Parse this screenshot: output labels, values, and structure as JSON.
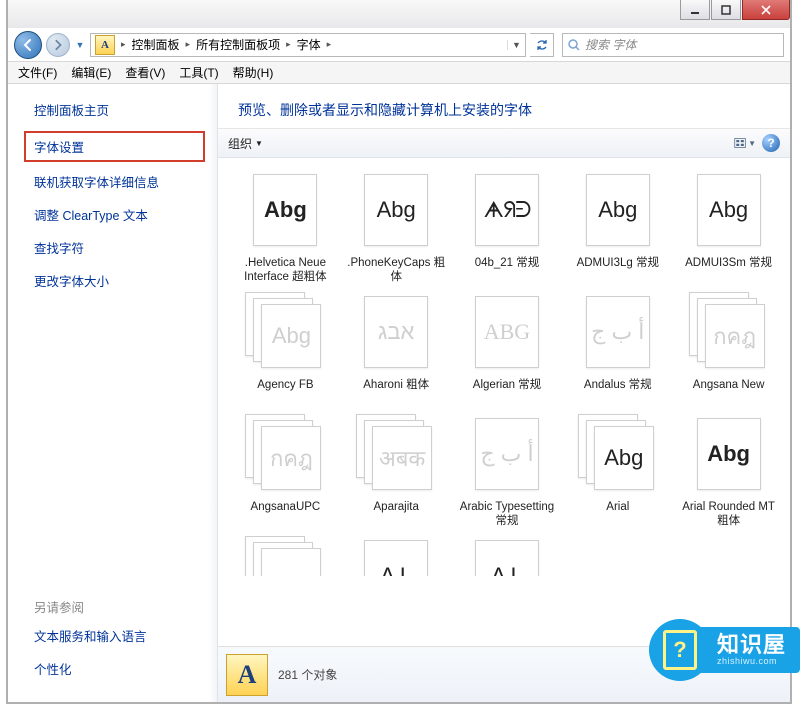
{
  "window": {
    "breadcrumbs": [
      "控制面板",
      "所有控制面板项",
      "字体"
    ],
    "search_placeholder": "搜索 字体"
  },
  "menu": {
    "file": "文件(F)",
    "edit": "编辑(E)",
    "view": "查看(V)",
    "tools": "工具(T)",
    "help": "帮助(H)"
  },
  "sidebar": {
    "home": "控制面板主页",
    "links": [
      "字体设置",
      "联机获取字体详细信息",
      "调整 ClearType 文本",
      "查找字符",
      "更改字体大小"
    ],
    "see_also_header": "另请参阅",
    "see_also": [
      "文本服务和输入语言",
      "个性化"
    ]
  },
  "content": {
    "title": "预览、删除或者显示和隐藏计算机上安装的字体",
    "organize": "组织"
  },
  "fonts": [
    {
      "label": ".Helvetica Neue Interface 超粗体",
      "sample": "Abg",
      "stack": false,
      "style": "heavy"
    },
    {
      "label": ".PhoneKeyCaps 粗体",
      "sample": "Abg",
      "stack": false,
      "style": ""
    },
    {
      "label": "04b_21 常规",
      "sample": "ᗗᖆᕭ",
      "stack": false,
      "style": "px"
    },
    {
      "label": "ADMUI3Lg 常规",
      "sample": "Abg",
      "stack": false,
      "style": ""
    },
    {
      "label": "ADMUI3Sm 常规",
      "sample": "Abg",
      "stack": false,
      "style": ""
    },
    {
      "label": "Agency FB",
      "sample": "Abg",
      "stack": true,
      "style": "dim"
    },
    {
      "label": "Aharoni 粗体",
      "sample": "אבג",
      "stack": false,
      "style": "dim"
    },
    {
      "label": "Algerian 常规",
      "sample": "ABG",
      "stack": false,
      "style": "serif dim"
    },
    {
      "label": "Andalus 常规",
      "sample": "أ ب ج",
      "stack": false,
      "style": "dim"
    },
    {
      "label": "Angsana New",
      "sample": "กคฎ",
      "stack": true,
      "style": "dim"
    },
    {
      "label": "AngsanaUPC",
      "sample": "กคฎ",
      "stack": true,
      "style": "dim"
    },
    {
      "label": "Aparajita",
      "sample": "अबक",
      "stack": true,
      "style": "dim"
    },
    {
      "label": "Arabic Typesetting 常规",
      "sample": "أ ب ج",
      "stack": false,
      "style": "dim"
    },
    {
      "label": "Arial",
      "sample": "Abg",
      "stack": true,
      "style": ""
    },
    {
      "label": "Arial Rounded MT 粗体",
      "sample": "Abg",
      "stack": false,
      "style": "heavy"
    }
  ],
  "fonts_partial": [
    {
      "label": "",
      "sample": "",
      "stack": true
    },
    {
      "label": "",
      "sample": "A L",
      "stack": false
    },
    {
      "label": "",
      "sample": "A L",
      "stack": false
    }
  ],
  "status": {
    "count_text": "281 个对象"
  },
  "badge": {
    "title": "知识屋",
    "sub": "zhishiwu.com",
    "mark": "?"
  }
}
